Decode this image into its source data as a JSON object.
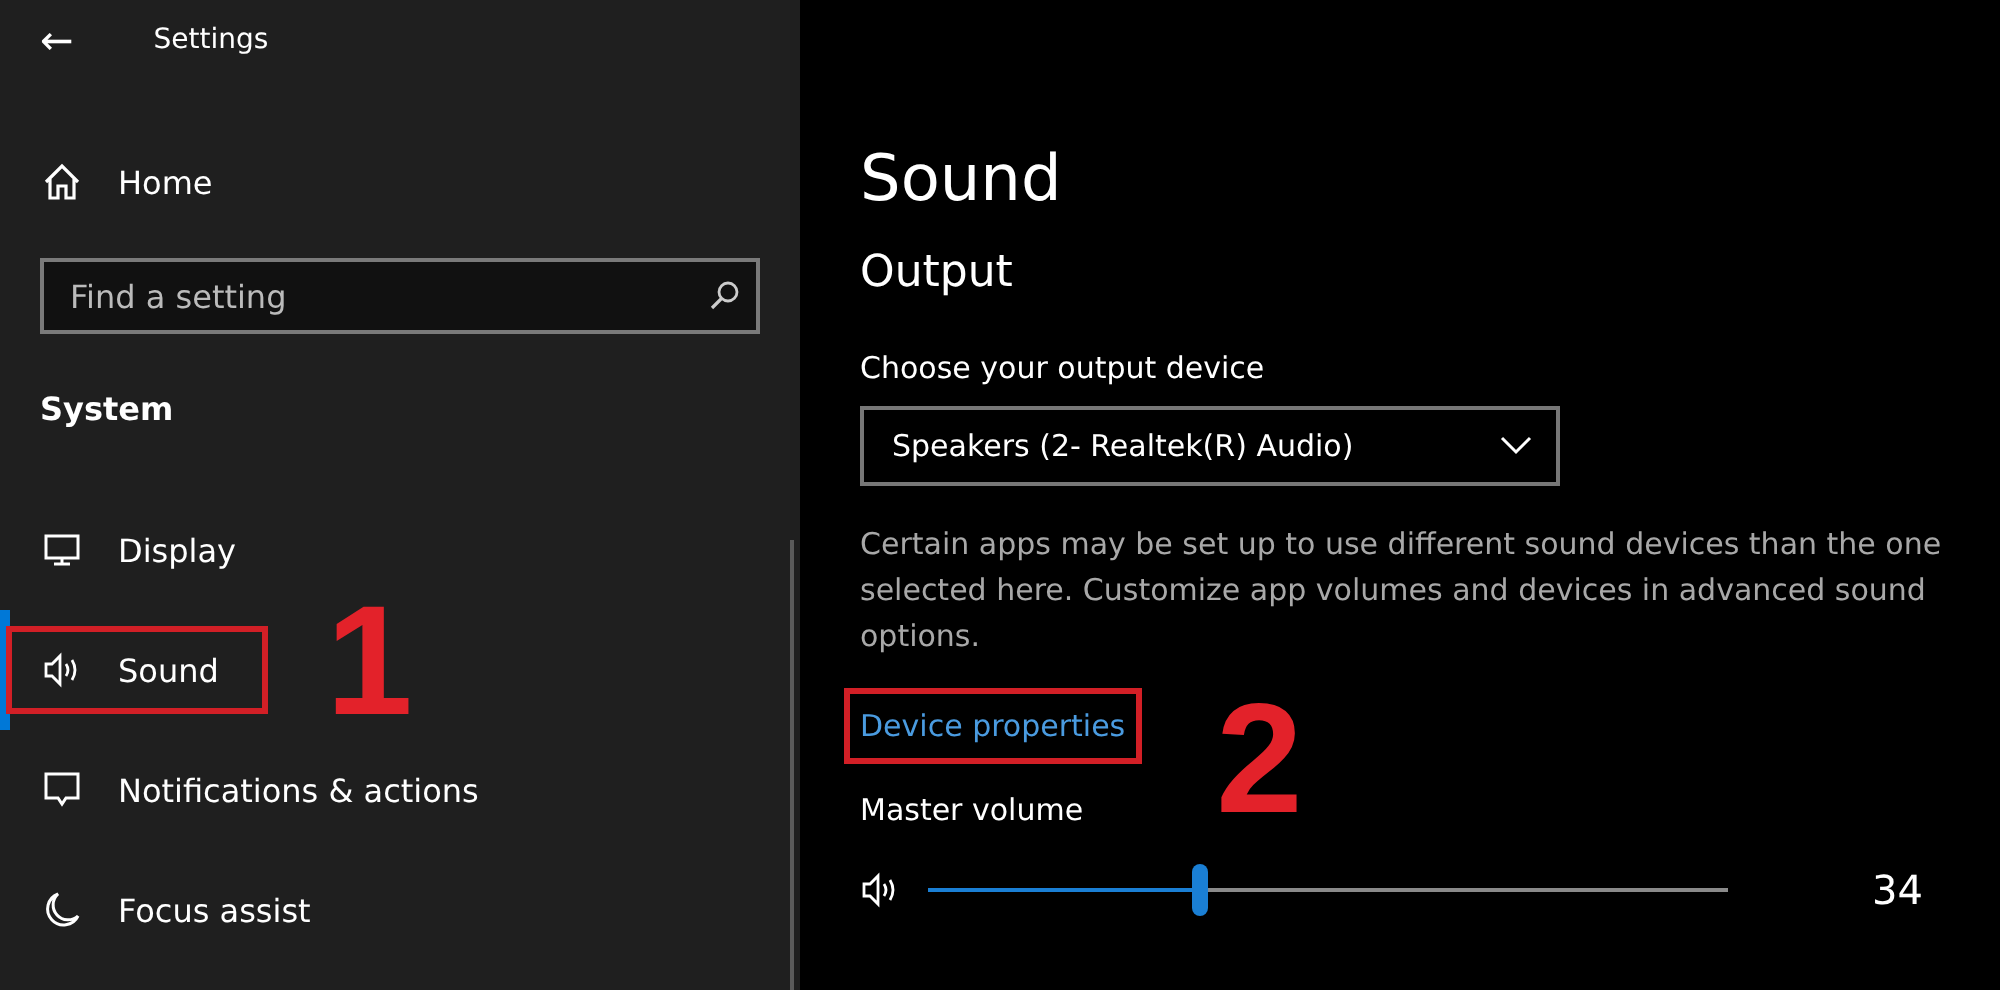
{
  "window": {
    "title": "Settings",
    "back": "←"
  },
  "sidebar": {
    "home": "Home",
    "search": {
      "placeholder": "Find a setting"
    },
    "section": "System",
    "items": [
      {
        "label": "Display",
        "selected": false,
        "highlighted": false
      },
      {
        "label": "Sound",
        "selected": true,
        "highlighted": true,
        "callout": "1"
      },
      {
        "label": "Notifications & actions",
        "selected": false,
        "highlighted": false
      },
      {
        "label": "Focus assist",
        "selected": false,
        "highlighted": false
      }
    ]
  },
  "page": {
    "title": "Sound",
    "section": "Output",
    "device_label": "Choose your output device",
    "device": "Speakers (2- Realtek(R) Audio)",
    "description": "Certain apps may be set up to use different sound devices than the one selected here. Customize app volumes and devices in advanced sound options.",
    "link": {
      "label": "Device properties",
      "highlighted": true,
      "callout": "2"
    },
    "volume": {
      "label": "Master volume",
      "level": 0.34,
      "reading": "34"
    }
  }
}
